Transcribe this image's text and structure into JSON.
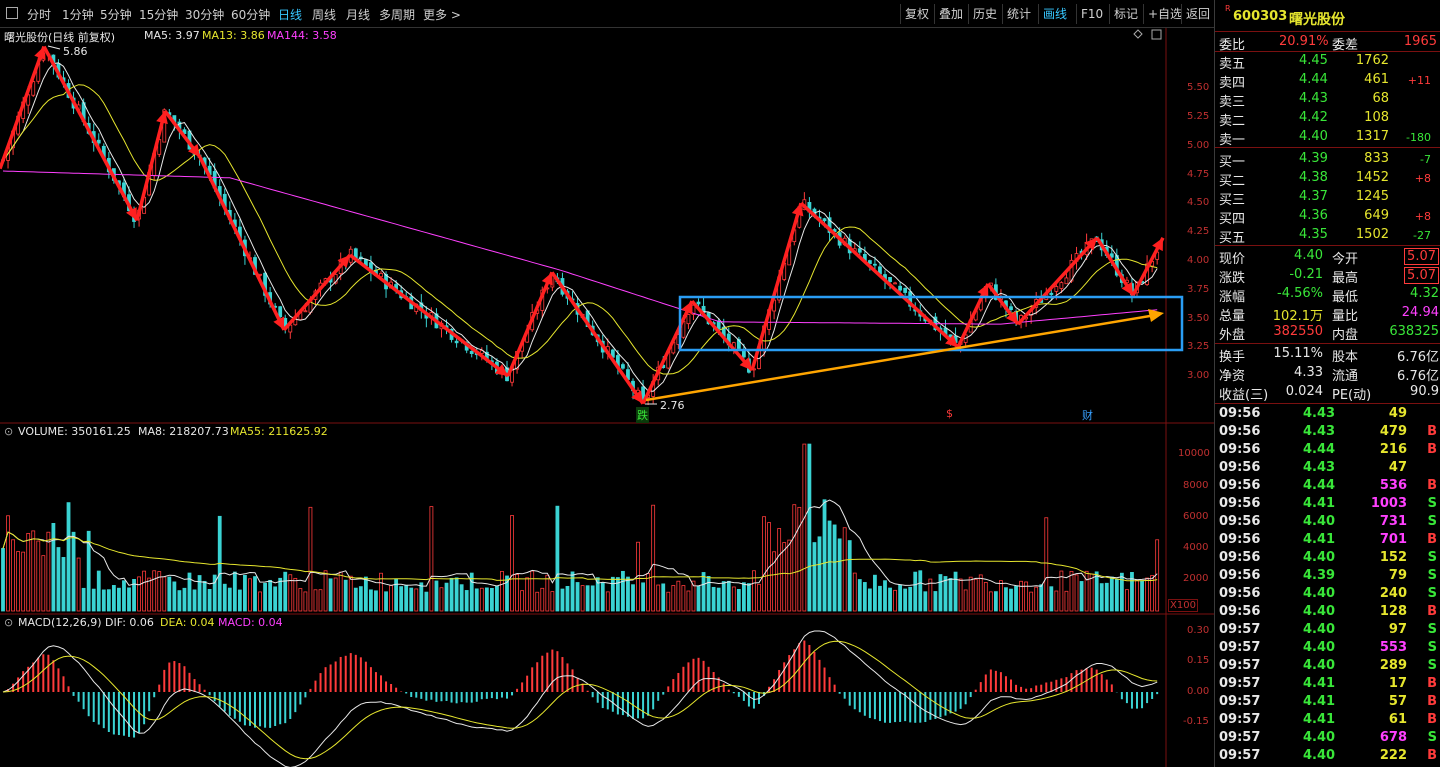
{
  "toolbar": {
    "left_icon": "window-icon",
    "periods": [
      "分时",
      "1分钟",
      "5分钟",
      "15分钟",
      "30分钟",
      "60分钟",
      "日线",
      "周线",
      "月线",
      "多周期",
      "更多"
    ],
    "active_period": "日线",
    "more_suffix": ">",
    "right_buttons": [
      "复权",
      "叠加",
      "历史",
      "统计",
      "画线",
      "F10",
      "标记",
      "+自选",
      "返回"
    ],
    "active_right": "画线"
  },
  "main_chart": {
    "title": "曙光股份(日线 前复权)",
    "ma_labels": [
      {
        "text": "MA5: 3.97",
        "color": "#e8e8e8"
      },
      {
        "text": "MA13: 3.86",
        "color": "#e6e62e"
      },
      {
        "text": "MA144: 3.58",
        "color": "#ff40ff"
      }
    ],
    "high_label": "5.86",
    "low_label": "2.76",
    "y_ticks": [
      "5.50",
      "5.25",
      "5.00",
      "4.75",
      "4.50",
      "4.25",
      "4.00",
      "3.75",
      "3.50",
      "3.25",
      "3.00"
    ],
    "markers": [
      {
        "text": "跌",
        "color": "#39e639"
      },
      {
        "text": "$",
        "color": "#ff3b3b"
      },
      {
        "text": "财",
        "color": "#37a0ff"
      }
    ]
  },
  "volume_chart": {
    "labels": [
      {
        "text": "VOLUME: 350161.25",
        "color": "#e8e8e8"
      },
      {
        "text": "MA8: 218207.73",
        "color": "#e8e8e8"
      },
      {
        "text": "MA55: 211625.92",
        "color": "#e6e62e"
      }
    ],
    "y_ticks": [
      "10000",
      "8000",
      "6000",
      "4000",
      "2000"
    ],
    "unit": "X100"
  },
  "macd_chart": {
    "labels": [
      {
        "text": "MACD(12,26,9)",
        "color": "#e8e8e8"
      },
      {
        "text": "DIF: 0.06",
        "color": "#e8e8e8"
      },
      {
        "text": "DEA: 0.04",
        "color": "#e6e62e"
      },
      {
        "text": "MACD: 0.04",
        "color": "#ff40ff"
      }
    ],
    "y_ticks": [
      "0.30",
      "0.15",
      "0.00",
      "-0.15"
    ]
  },
  "panel": {
    "code": "600303",
    "name": "曙光股份",
    "r_badge": "R",
    "weibi_label": "委比",
    "weibi_value": "20.91%",
    "weicha_label": "委差",
    "weicha_value": "1965",
    "sells": [
      {
        "label": "卖五",
        "price": "4.45",
        "vol": "1762",
        "chg": ""
      },
      {
        "label": "卖四",
        "price": "4.44",
        "vol": "461",
        "chg": "+11"
      },
      {
        "label": "卖三",
        "price": "4.43",
        "vol": "68",
        "chg": ""
      },
      {
        "label": "卖二",
        "price": "4.42",
        "vol": "108",
        "chg": ""
      },
      {
        "label": "卖一",
        "price": "4.40",
        "vol": "1317",
        "chg": "-180"
      }
    ],
    "buys": [
      {
        "label": "买一",
        "price": "4.39",
        "vol": "833",
        "chg": "-7"
      },
      {
        "label": "买二",
        "price": "4.38",
        "vol": "1452",
        "chg": "+8"
      },
      {
        "label": "买三",
        "price": "4.37",
        "vol": "1245",
        "chg": ""
      },
      {
        "label": "买四",
        "price": "4.36",
        "vol": "649",
        "chg": "+8"
      },
      {
        "label": "买五",
        "price": "4.35",
        "vol": "1502",
        "chg": "-27"
      }
    ],
    "stats": [
      {
        "l1": "现价",
        "v1": "4.40",
        "c1": "green",
        "l2": "今开",
        "v2": "5.07",
        "c2": "red",
        "box2": true
      },
      {
        "l1": "涨跌",
        "v1": "-0.21",
        "c1": "green",
        "l2": "最高",
        "v2": "5.07",
        "c2": "red",
        "box2": true
      },
      {
        "l1": "涨幅",
        "v1": "-4.56%",
        "c1": "green",
        "l2": "最低",
        "v2": "4.32",
        "c2": "green",
        "box2": false
      },
      {
        "l1": "总量",
        "v1": "102.1万",
        "c1": "yellow",
        "l2": "量比",
        "v2": "24.94",
        "c2": "magenta",
        "box2": false
      },
      {
        "l1": "外盘",
        "v1": "382550",
        "c1": "red",
        "l2": "内盘",
        "v2": "638325",
        "c2": "green",
        "box2": false
      }
    ],
    "stats2": [
      {
        "l1": "换手",
        "v1": "15.11%",
        "l2": "股本",
        "v2": "6.76亿"
      },
      {
        "l1": "净资",
        "v1": "4.33",
        "l2": "流通",
        "v2": "6.76亿"
      },
      {
        "l1": "收益(三)",
        "v1": "0.024",
        "l2": "PE(动)",
        "v2": "90.9"
      }
    ],
    "ticks": [
      {
        "t": "09:56",
        "p": "4.43",
        "pc": "green",
        "v": "49",
        "vc": "yellow",
        "s": ""
      },
      {
        "t": "09:56",
        "p": "4.43",
        "pc": "green",
        "v": "479",
        "vc": "yellow",
        "s": "B"
      },
      {
        "t": "09:56",
        "p": "4.44",
        "pc": "green",
        "v": "216",
        "vc": "yellow",
        "s": "B"
      },
      {
        "t": "09:56",
        "p": "4.43",
        "pc": "green",
        "v": "47",
        "vc": "yellow",
        "s": ""
      },
      {
        "t": "09:56",
        "p": "4.44",
        "pc": "green",
        "v": "536",
        "vc": "magenta",
        "s": "B"
      },
      {
        "t": "09:56",
        "p": "4.41",
        "pc": "green",
        "v": "1003",
        "vc": "magenta",
        "s": "S"
      },
      {
        "t": "09:56",
        "p": "4.40",
        "pc": "green",
        "v": "731",
        "vc": "magenta",
        "s": "S"
      },
      {
        "t": "09:56",
        "p": "4.41",
        "pc": "green",
        "v": "701",
        "vc": "magenta",
        "s": "B"
      },
      {
        "t": "09:56",
        "p": "4.40",
        "pc": "green",
        "v": "152",
        "vc": "yellow",
        "s": "S"
      },
      {
        "t": "09:56",
        "p": "4.39",
        "pc": "green",
        "v": "79",
        "vc": "yellow",
        "s": "S"
      },
      {
        "t": "09:56",
        "p": "4.40",
        "pc": "green",
        "v": "240",
        "vc": "yellow",
        "s": "S"
      },
      {
        "t": "09:56",
        "p": "4.40",
        "pc": "green",
        "v": "128",
        "vc": "yellow",
        "s": "B"
      },
      {
        "t": "09:57",
        "p": "4.40",
        "pc": "green",
        "v": "97",
        "vc": "yellow",
        "s": "S"
      },
      {
        "t": "09:57",
        "p": "4.40",
        "pc": "green",
        "v": "553",
        "vc": "magenta",
        "s": "S"
      },
      {
        "t": "09:57",
        "p": "4.40",
        "pc": "green",
        "v": "289",
        "vc": "yellow",
        "s": "S"
      },
      {
        "t": "09:57",
        "p": "4.41",
        "pc": "green",
        "v": "17",
        "vc": "yellow",
        "s": "B"
      },
      {
        "t": "09:57",
        "p": "4.41",
        "pc": "green",
        "v": "57",
        "vc": "yellow",
        "s": "B"
      },
      {
        "t": "09:57",
        "p": "4.41",
        "pc": "green",
        "v": "61",
        "vc": "yellow",
        "s": "B"
      },
      {
        "t": "09:57",
        "p": "4.40",
        "pc": "green",
        "v": "678",
        "vc": "magenta",
        "s": "S"
      },
      {
        "t": "09:57",
        "p": "4.40",
        "pc": "green",
        "v": "222",
        "vc": "yellow",
        "s": "B"
      }
    ]
  },
  "chart_data": [
    {
      "type": "line",
      "title": "曙光股份(日线 前复权)",
      "ylim": [
        2.76,
        5.86
      ],
      "series": [
        {
          "name": "MA5",
          "values": [
            3.97
          ]
        },
        {
          "name": "MA13",
          "values": [
            3.86
          ]
        },
        {
          "name": "MA144",
          "values": [
            3.58
          ]
        }
      ],
      "zigzag_prices": [
        4.8,
        5.86,
        4.35,
        5.3,
        4.9,
        3.4,
        4.05,
        3.0,
        3.9,
        2.76,
        3.65,
        3.05,
        4.5,
        3.25,
        3.8,
        3.45,
        4.2,
        3.7,
        4.2
      ]
    },
    {
      "type": "bar",
      "series": [
        {
          "name": "VOLUME",
          "values": [
            350161.25
          ]
        },
        {
          "name": "MA8",
          "values": [
            218207.73
          ]
        },
        {
          "name": "MA55",
          "values": [
            211625.92
          ]
        }
      ]
    },
    {
      "type": "bar",
      "series": [
        {
          "name": "DIF",
          "values": [
            0.06
          ]
        },
        {
          "name": "DEA",
          "values": [
            0.04
          ]
        },
        {
          "name": "MACD",
          "values": [
            0.04
          ]
        }
      ]
    }
  ]
}
